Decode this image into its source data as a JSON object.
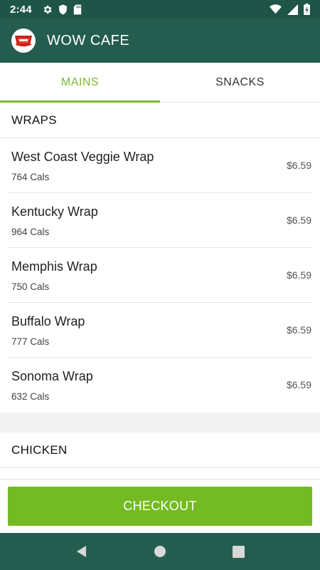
{
  "status_bar": {
    "time": "2:44",
    "left_icons": [
      "gear-icon",
      "shield-icon",
      "sd-card-icon"
    ],
    "right_icons": [
      "wifi-icon",
      "signal-icon",
      "battery-charging-icon"
    ]
  },
  "app_bar": {
    "title": "WOW CAFE",
    "logo": "wow-cafe-logo-icon"
  },
  "tabs": [
    {
      "label": "MAINS",
      "active": true
    },
    {
      "label": "SNACKS",
      "active": false
    }
  ],
  "sections": [
    {
      "title": "WRAPS",
      "items": [
        {
          "name": "West Coast Veggie Wrap",
          "cals": "764 Cals",
          "price": "$6.59"
        },
        {
          "name": "Kentucky Wrap",
          "cals": "964 Cals",
          "price": "$6.59"
        },
        {
          "name": "Memphis Wrap",
          "cals": "750 Cals",
          "price": "$6.59"
        },
        {
          "name": "Buffalo Wrap",
          "cals": "777 Cals",
          "price": "$6.59"
        },
        {
          "name": "Sonoma Wrap",
          "cals": "632 Cals",
          "price": "$6.59"
        }
      ]
    },
    {
      "title": "CHICKEN",
      "items": []
    }
  ],
  "checkout": {
    "label": "CHECKOUT"
  },
  "colors": {
    "primary": "#245d4f",
    "status_bar": "#1e5548",
    "accent": "#7ab934",
    "checkout": "#74bb23"
  },
  "nav_bar": {
    "buttons": [
      "back-icon",
      "home-icon",
      "recents-icon"
    ]
  }
}
